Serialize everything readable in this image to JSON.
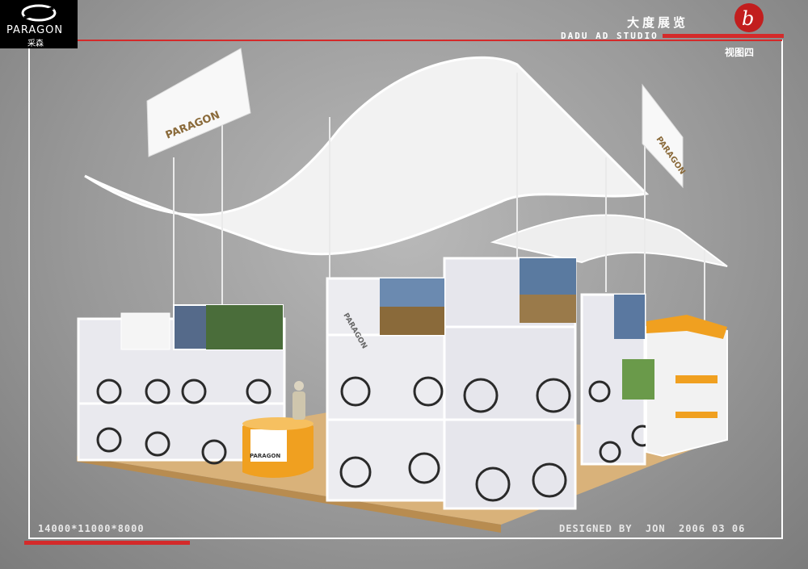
{
  "header": {
    "brand_logo": "PARAGON",
    "brand_logo_cn": "采森",
    "studio_name_cn": "大度展览",
    "studio_name_en": "DADU AD STUDIO",
    "view_label": "视图四"
  },
  "footer": {
    "dimensions": "14000*11000*8000",
    "designer": "DESIGNED BY  JON  2006 03 06"
  },
  "booth_signage": {
    "left_banner": "PARAGON",
    "right_banner": "PARAGON",
    "display_box": "PARAGON",
    "reception_desk": "PARAGON"
  },
  "colors": {
    "accent_red": "#d42a2a",
    "frame_white": "#ffffff",
    "floor_wood": "#d9b27a",
    "desk_orange": "#f0a020"
  }
}
